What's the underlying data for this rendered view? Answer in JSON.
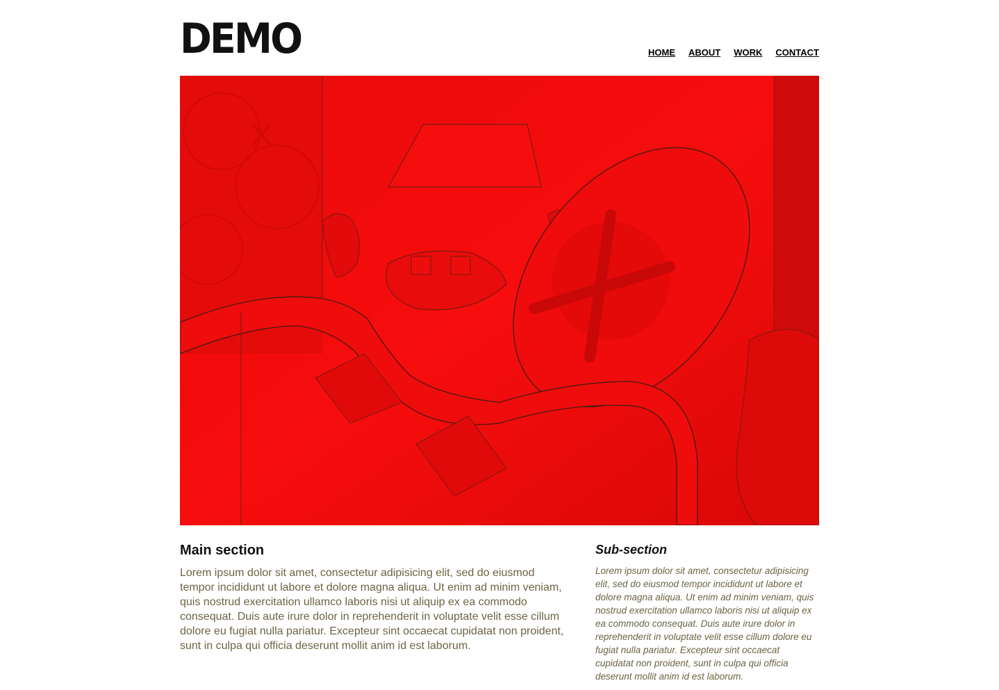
{
  "header": {
    "logo": "DEMO",
    "nav": [
      {
        "label": "HOME"
      },
      {
        "label": "ABOUT"
      },
      {
        "label": "WORK"
      },
      {
        "label": "CONTACT"
      }
    ]
  },
  "hero": {
    "icon": "red-artwork-image"
  },
  "main": {
    "title": "Main section",
    "body": "Lorem ipsum dolor sit amet, consectetur adipisicing elit, sed do eiusmod tempor incididunt ut labore et dolore magna aliqua. Ut enim ad minim veniam, quis nostrud exercitation ullamco laboris nisi ut aliquip ex ea commodo consequat. Duis aute irure dolor in reprehenderit in voluptate velit esse cillum dolore eu fugiat nulla pariatur. Excepteur sint occaecat cupidatat non proident, sunt in culpa qui officia deserunt mollit anim id est laborum."
  },
  "sub": {
    "title": "Sub-section",
    "body": "Lorem ipsum dolor sit amet, consectetur adipisicing elit, sed do eiusmod tempor incididunt ut labore et dolore magna aliqua. Ut enim ad minim veniam, quis nostrud exercitation ullamco laboris nisi ut aliquip ex ea commodo consequat. Duis aute irure dolor in reprehenderit in voluptate velit esse cillum dolore eu fugiat nulla pariatur. Excepteur sint occaecat cupidatat non proident, sunt in culpa qui officia deserunt mollit anim id est laborum."
  },
  "colors": {
    "text_body": "#6b6443",
    "text_heading": "#111111",
    "hero_red": "#f20c0c"
  }
}
